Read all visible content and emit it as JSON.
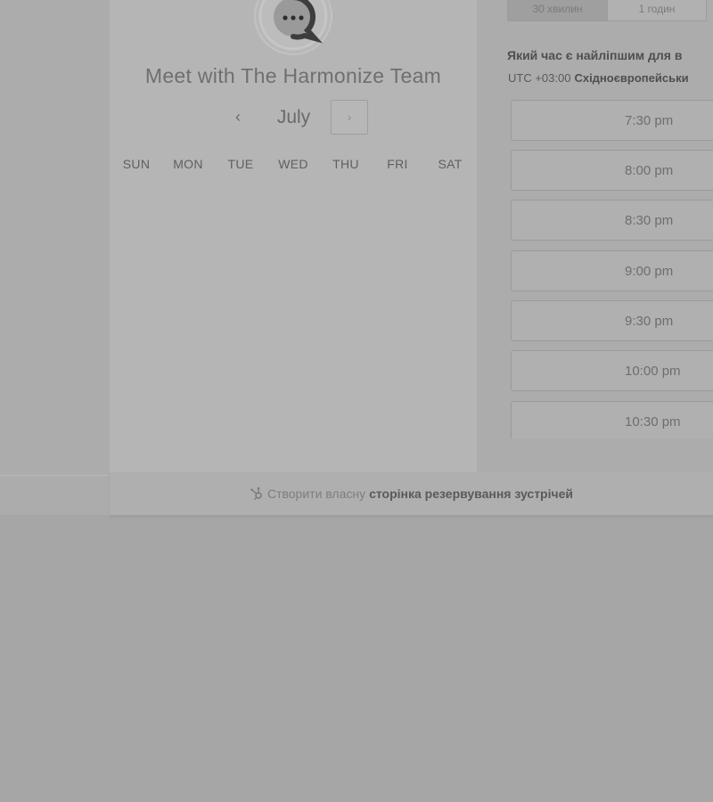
{
  "header": {
    "title": "Meet with The Harmonize Team"
  },
  "calendar": {
    "month": "July",
    "prev_icon": "‹",
    "next_icon": "›",
    "weekdays": [
      "SUN",
      "MON",
      "TUE",
      "WED",
      "THU",
      "FRI",
      "SAT"
    ]
  },
  "duration": {
    "options": [
      "30 хвилин",
      "1 годин"
    ],
    "selected": "30 хвилин"
  },
  "time_picker": {
    "question": "Який час є найліпшим для в",
    "timezone_offset": "UTC +03:00",
    "timezone_name": "Східноєвропейськи",
    "slots": [
      "7:30 pm",
      "8:00 pm",
      "8:30 pm",
      "9:00 pm",
      "9:30 pm",
      "10:00 pm",
      "10:30 pm"
    ]
  },
  "footer": {
    "text": "Створити власну",
    "link": "сторінка резервування зустрічей",
    "icon": "hubspot-sprocket-icon"
  },
  "colors": {
    "overlay": "#a6a6a6",
    "panel": "#b5b5b5"
  }
}
